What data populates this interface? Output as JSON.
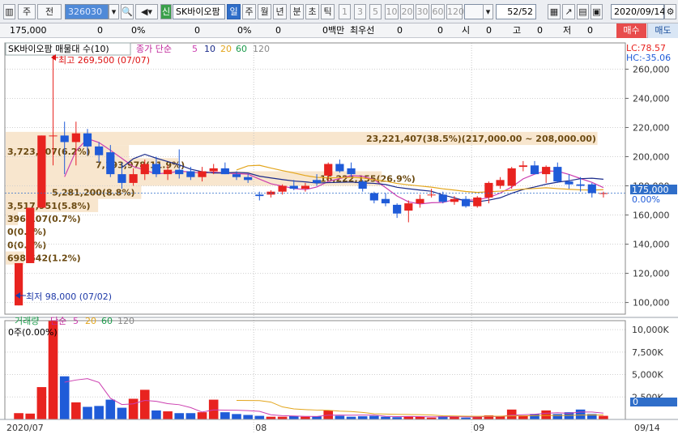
{
  "toolbar": {
    "period": "주",
    "adj": "전",
    "code": "326030",
    "stock_name": "SK바이오팜",
    "period_tabs": [
      "일",
      "주",
      "월",
      "년",
      "분",
      "초",
      "틱"
    ],
    "nums": [
      "1",
      "3",
      "5",
      "10",
      "20",
      "30",
      "60",
      "120"
    ],
    "page": "52",
    "page_total": "/52",
    "date": "2020/09/14"
  },
  "quote": {
    "price": "175,000",
    "change": "0",
    "change_pct": "0%",
    "v3": "0",
    "v3pct": "0%",
    "v4": "0",
    "v4pct": "0%",
    "volume_label": "0백만",
    "bid_label": "최우선",
    "bid1": "0",
    "bid2": "0",
    "open_label": "시",
    "open": "0",
    "high_label": "고",
    "high": "0",
    "low_label": "저",
    "low": "0"
  },
  "buttons": {
    "buy": "매수",
    "sell": "매도"
  },
  "legend": {
    "name_box": "SK바이오팜 매물대 수(10)",
    "close_label": "종가 단순",
    "ma_periods": [
      "5",
      "10",
      "20",
      "60",
      "120"
    ],
    "lc": "LC:78.57",
    "hc": "HC:-35.06"
  },
  "volume_legend": {
    "label": "거래량",
    "simple": "단순",
    "periods": [
      "5",
      "20",
      "60",
      "120"
    ],
    "current": "0주(0.00%)"
  },
  "annotations": {
    "high": "최고 269,500 (07/07)",
    "low": "최저 98,000 (07/02)",
    "top_zone": "23,221,407(38.5%)(217,000.00 ~ 208,000.00)"
  },
  "current_price": {
    "label": "175,000",
    "pct": "0.00%"
  },
  "colors": {
    "up": "#e8231f",
    "down": "#1f5bd8",
    "ma5": "#cc3fb0",
    "ma10": "#1a2a8a",
    "ma20": "#e3a51b",
    "ma60": "#1a9a4a"
  },
  "chart_data": {
    "type": "candlestick",
    "y_ticks": [
      100000,
      120000,
      140000,
      160000,
      180000,
      200000,
      220000,
      240000,
      260000
    ],
    "y_tick_labels": [
      "100,000",
      "120,000",
      "140,000",
      "160,000",
      "180,000",
      "200,000",
      "220,000",
      "240,000",
      "260,000"
    ],
    "ylim": [
      92000,
      278000
    ],
    "x_labels": [
      {
        "i": 0,
        "text": "2020/07"
      },
      {
        "i": 21,
        "text": "08"
      },
      {
        "i": 40,
        "text": "09"
      },
      {
        "i": 51,
        "text": "09/14"
      }
    ],
    "candles": [
      {
        "o": 98000,
        "h": 127000,
        "l": 98000,
        "c": 127000
      },
      {
        "o": 127000,
        "h": 165000,
        "l": 127000,
        "c": 165000
      },
      {
        "o": 165000,
        "h": 214500,
        "l": 165000,
        "c": 214500
      },
      {
        "o": 214500,
        "h": 269500,
        "l": 194000,
        "c": 214500
      },
      {
        "o": 214500,
        "h": 224000,
        "l": 188000,
        "c": 210000
      },
      {
        "o": 210000,
        "h": 224000,
        "l": 194000,
        "c": 216000
      },
      {
        "o": 216000,
        "h": 219000,
        "l": 201000,
        "c": 207000
      },
      {
        "o": 207000,
        "h": 210000,
        "l": 196000,
        "c": 201000
      },
      {
        "o": 203000,
        "h": 208000,
        "l": 186000,
        "c": 188000
      },
      {
        "o": 188000,
        "h": 196000,
        "l": 178000,
        "c": 182000
      },
      {
        "o": 182000,
        "h": 192000,
        "l": 180000,
        "c": 188000
      },
      {
        "o": 188000,
        "h": 198000,
        "l": 184000,
        "c": 195000
      },
      {
        "o": 195000,
        "h": 200000,
        "l": 186000,
        "c": 188000
      },
      {
        "o": 188000,
        "h": 194000,
        "l": 184000,
        "c": 191000
      },
      {
        "o": 191000,
        "h": 205000,
        "l": 185000,
        "c": 188000
      },
      {
        "o": 190000,
        "h": 193000,
        "l": 184000,
        "c": 186000
      },
      {
        "o": 186000,
        "h": 193000,
        "l": 183000,
        "c": 190000
      },
      {
        "o": 190000,
        "h": 195000,
        "l": 188000,
        "c": 192000
      },
      {
        "o": 192000,
        "h": 196000,
        "l": 188000,
        "c": 188000
      },
      {
        "o": 188000,
        "h": 190000,
        "l": 184000,
        "c": 186000
      },
      {
        "o": 186000,
        "h": 188000,
        "l": 182000,
        "c": 184000
      },
      {
        "o": 174000,
        "h": 176000,
        "l": 170000,
        "c": 173000
      },
      {
        "o": 174000,
        "h": 177000,
        "l": 172000,
        "c": 176000
      },
      {
        "o": 176000,
        "h": 181000,
        "l": 174000,
        "c": 180000
      },
      {
        "o": 180000,
        "h": 184000,
        "l": 177000,
        "c": 178000
      },
      {
        "o": 178000,
        "h": 182000,
        "l": 176000,
        "c": 180000
      },
      {
        "o": 184000,
        "h": 188000,
        "l": 180000,
        "c": 182000
      },
      {
        "o": 187000,
        "h": 196000,
        "l": 184000,
        "c": 195000
      },
      {
        "o": 195000,
        "h": 198000,
        "l": 189000,
        "c": 190000
      },
      {
        "o": 192000,
        "h": 196000,
        "l": 186000,
        "c": 188000
      },
      {
        "o": 183000,
        "h": 184000,
        "l": 176000,
        "c": 178000
      },
      {
        "o": 175000,
        "h": 176000,
        "l": 168000,
        "c": 170000
      },
      {
        "o": 171000,
        "h": 175000,
        "l": 166000,
        "c": 168000
      },
      {
        "o": 167000,
        "h": 168000,
        "l": 158000,
        "c": 161000
      },
      {
        "o": 163000,
        "h": 170000,
        "l": 155000,
        "c": 168000
      },
      {
        "o": 168000,
        "h": 174000,
        "l": 165000,
        "c": 171000
      },
      {
        "o": 174000,
        "h": 178000,
        "l": 172000,
        "c": 174000
      },
      {
        "o": 174000,
        "h": 176000,
        "l": 168000,
        "c": 169000
      },
      {
        "o": 169000,
        "h": 173000,
        "l": 167000,
        "c": 171000
      },
      {
        "o": 171000,
        "h": 173000,
        "l": 165000,
        "c": 166000
      },
      {
        "o": 166000,
        "h": 173000,
        "l": 165000,
        "c": 172000
      },
      {
        "o": 172000,
        "h": 183000,
        "l": 168000,
        "c": 182000
      },
      {
        "o": 180000,
        "h": 186000,
        "l": 178000,
        "c": 184000
      },
      {
        "o": 180000,
        "h": 193000,
        "l": 178000,
        "c": 192000
      },
      {
        "o": 193000,
        "h": 197000,
        "l": 190000,
        "c": 194000
      },
      {
        "o": 194000,
        "h": 197000,
        "l": 188000,
        "c": 188000
      },
      {
        "o": 188000,
        "h": 194000,
        "l": 182000,
        "c": 193000
      },
      {
        "o": 193000,
        "h": 196000,
        "l": 182000,
        "c": 183000
      },
      {
        "o": 183000,
        "h": 188000,
        "l": 178000,
        "c": 181000
      },
      {
        "o": 181000,
        "h": 186000,
        "l": 176000,
        "c": 180000
      },
      {
        "o": 181000,
        "h": 182000,
        "l": 172000,
        "c": 175000
      },
      {
        "o": 175000,
        "h": 176000,
        "l": 172000,
        "c": 175000
      }
    ],
    "volume_ticks": [
      2500,
      5000,
      7500,
      10000
    ],
    "volume_tick_labels": [
      "2,500K",
      "5,000K",
      "7,500K",
      "10,000K"
    ],
    "volume_ylim": [
      0,
      11000
    ],
    "volume_current_label": "0",
    "volumes": [
      700,
      650,
      3600,
      11000,
      4800,
      1900,
      1400,
      1500,
      2200,
      1300,
      2300,
      3300,
      1000,
      900,
      700,
      700,
      800,
      2200,
      800,
      600,
      500,
      400,
      300,
      300,
      400,
      300,
      350,
      1000,
      400,
      300,
      350,
      400,
      300,
      250,
      350,
      300,
      200,
      350,
      350,
      200,
      300,
      450,
      350,
      1100,
      400,
      600,
      1000,
      600,
      800,
      1100,
      600,
      400
    ],
    "volume_profile": [
      {
        "price_low": 208000,
        "price_high": 217000,
        "label": "23,221,407(38.5%)",
        "w": 0.96
      },
      {
        "price_low": 199000,
        "price_high": 208000,
        "label": "3,723,007(6.2%)",
        "w": 0.2
      },
      {
        "price_low": 190000,
        "price_high": 199000,
        "label": "7,193,978(11.9%)",
        "w": 0.28
      },
      {
        "price_low": 180000,
        "price_high": 190000,
        "label": "16,222,155(26.9%)",
        "w": 0.61
      },
      {
        "price_low": 171000,
        "price_high": 180000,
        "label": "5,281,200(8.8%)",
        "w": 0.22
      },
      {
        "price_low": 162000,
        "price_high": 171000,
        "label": "3,517,951(5.8%)",
        "w": 0.15
      },
      {
        "price_low": 153000,
        "price_high": 162000,
        "label": "396,107(0.7%)",
        "w": 0.02
      },
      {
        "price_low": 144000,
        "price_high": 153000,
        "label": "0(0.0%)",
        "w": 0
      },
      {
        "price_low": 135000,
        "price_high": 144000,
        "label": "0(0.0%)",
        "w": 0
      },
      {
        "price_low": 126000,
        "price_high": 135000,
        "label": "698,642(1.2%)",
        "w": 0.03
      }
    ]
  }
}
